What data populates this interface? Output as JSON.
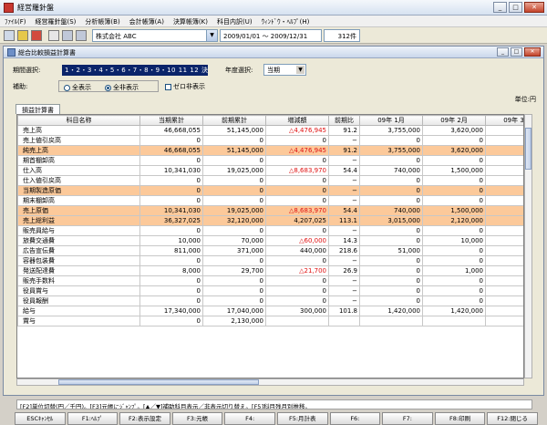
{
  "window": {
    "title": "経営羅針盤"
  },
  "menu": [
    "ﾌｧｲﾙ(F)",
    "経営羅針盤(S)",
    "分析帳簿(B)",
    "会計帳簿(A)",
    "決算帳簿(K)",
    "科目内訳(U)",
    "ｳｨﾝﾄﾞｳ・ﾍﾙﾌﾟ(H)"
  ],
  "toolbar": {
    "company": "株式会社 ABC",
    "date_range": "2009/01/01 〜 2009/12/31",
    "count": "312件"
  },
  "report": {
    "title": "総合比較損益計算書",
    "period_label": "期間選択:",
    "period_value": "1・2・3・4・5・6・7・8・9・10 11 12 決",
    "year_label": "年度選択:",
    "year_value": "当期",
    "aux_label": "補助:",
    "radio_all": "全表示",
    "radio_hide_all": "全非表示",
    "zero_hide": "ゼロ非表示",
    "unit": "単位:円",
    "tab": "損益計算書"
  },
  "table": {
    "headers": [
      "科目名称",
      "当期累計",
      "前期累計",
      "増減額",
      "前期比",
      "09年 1月",
      "09年 2月",
      "09年 3"
    ],
    "rows": [
      {
        "hl": false,
        "cells": [
          "売上高",
          "46,668,055",
          "51,145,000",
          "△4,476,945",
          "91.2",
          "3,755,000",
          "3,620,000",
          "3,"
        ]
      },
      {
        "hl": false,
        "cells": [
          "売上値引戻高",
          "0",
          "0",
          "0",
          "−",
          "0",
          "0",
          ""
        ]
      },
      {
        "hl": true,
        "cells": [
          "純売上高",
          "46,668,055",
          "51,145,000",
          "△4,476,945",
          "91.2",
          "3,755,000",
          "3,620,000",
          "3,"
        ]
      },
      {
        "hl": false,
        "cells": [
          "期首棚卸高",
          "0",
          "0",
          "0",
          "−",
          "0",
          "0",
          ""
        ]
      },
      {
        "hl": false,
        "cells": [
          "仕入高",
          "10,341,030",
          "19,025,000",
          "△8,683,970",
          "54.4",
          "740,000",
          "1,500,000",
          "1,"
        ]
      },
      {
        "hl": false,
        "cells": [
          "仕入値引戻高",
          "0",
          "0",
          "0",
          "−",
          "0",
          "0",
          ""
        ]
      },
      {
        "hl": true,
        "cells": [
          "当期製造原価",
          "0",
          "0",
          "0",
          "−",
          "0",
          "0",
          ""
        ]
      },
      {
        "hl": false,
        "cells": [
          "期末棚卸高",
          "0",
          "0",
          "0",
          "−",
          "0",
          "0",
          ""
        ]
      },
      {
        "hl": true,
        "cells": [
          "売上原価",
          "10,341,030",
          "19,025,000",
          "△8,683,970",
          "54.4",
          "740,000",
          "1,500,000",
          "1,"
        ]
      },
      {
        "hl": true,
        "cells": [
          "売上総利益",
          "36,327,025",
          "32,120,000",
          "4,207,025",
          "113.1",
          "3,015,000",
          "2,120,000",
          "1,"
        ]
      },
      {
        "hl": false,
        "cells": [
          "販売員給与",
          "0",
          "0",
          "0",
          "−",
          "0",
          "0",
          ""
        ]
      },
      {
        "hl": false,
        "cells": [
          "旅費交通費",
          "10,000",
          "70,000",
          "△60,000",
          "14.3",
          "0",
          "10,000",
          ""
        ]
      },
      {
        "hl": false,
        "cells": [
          "広告宣伝費",
          "811,000",
          "371,000",
          "440,000",
          "218.6",
          "51,000",
          "0",
          ""
        ]
      },
      {
        "hl": false,
        "cells": [
          "容器包装費",
          "0",
          "0",
          "0",
          "−",
          "0",
          "0",
          ""
        ]
      },
      {
        "hl": false,
        "cells": [
          "発送配達費",
          "8,000",
          "29,700",
          "△21,700",
          "26.9",
          "0",
          "1,000",
          ""
        ]
      },
      {
        "hl": false,
        "cells": [
          "販売手数料",
          "0",
          "0",
          "0",
          "−",
          "0",
          "0",
          ""
        ]
      },
      {
        "hl": false,
        "cells": [
          "役員賞与",
          "0",
          "0",
          "0",
          "−",
          "0",
          "0",
          ""
        ]
      },
      {
        "hl": false,
        "cells": [
          "役員報酬",
          "0",
          "0",
          "0",
          "−",
          "0",
          "0",
          ""
        ]
      },
      {
        "hl": false,
        "cells": [
          "給与",
          "17,340,000",
          "17,040,000",
          "300,000",
          "101.8",
          "1,420,000",
          "1,420,000",
          "1,"
        ]
      },
      {
        "hl": false,
        "cells": [
          "賞与",
          "0",
          "2,130,000",
          "",
          "",
          "",
          "",
          ""
        ]
      }
    ]
  },
  "hint": "[F2]単位切替(円／千円)。[F3]元帳にｼﾞｬﾝﾌﾟ。[▲／▼]補助科目表示／非表示切り替え。[F5]科目残月別推移。",
  "fkeys": [
    "ESCｷｬﾝｾﾙ",
    "F1:ﾍﾙﾌﾟ",
    "F2:表示設定",
    "F3:元帳",
    "F4:",
    "F5:月計表",
    "F6:",
    "F7:",
    "F8:印刷",
    "F12:閉じる"
  ]
}
